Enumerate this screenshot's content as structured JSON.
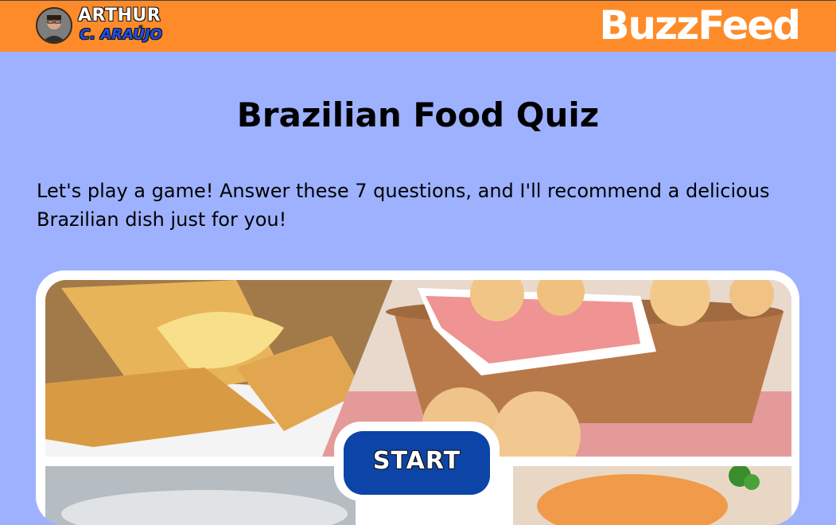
{
  "header": {
    "author_first": "ARTHUR",
    "author_last": "C. ARAÚJO",
    "brand": "BuzzFeed",
    "colors": {
      "bar": "#fe8b2a",
      "author_accent": "#1f4fe0"
    }
  },
  "main": {
    "title": "Brazilian Food Quiz",
    "intro": "Let's play a game! Answer these 7 questions, and I'll recommend a delicious Brazilian dish just for you!",
    "start_label": "START",
    "colors": {
      "background": "#9db1fe",
      "start_button": "#0c44a8"
    }
  },
  "images": [
    {
      "name": "pastel",
      "icon": "fried-pastry-photo"
    },
    {
      "name": "pao-de-queijo",
      "icon": "cheese-bread-basket-photo"
    },
    {
      "name": "dish-bottom-left",
      "icon": "food-photo"
    },
    {
      "name": "dish-bottom-right",
      "icon": "food-photo"
    }
  ]
}
